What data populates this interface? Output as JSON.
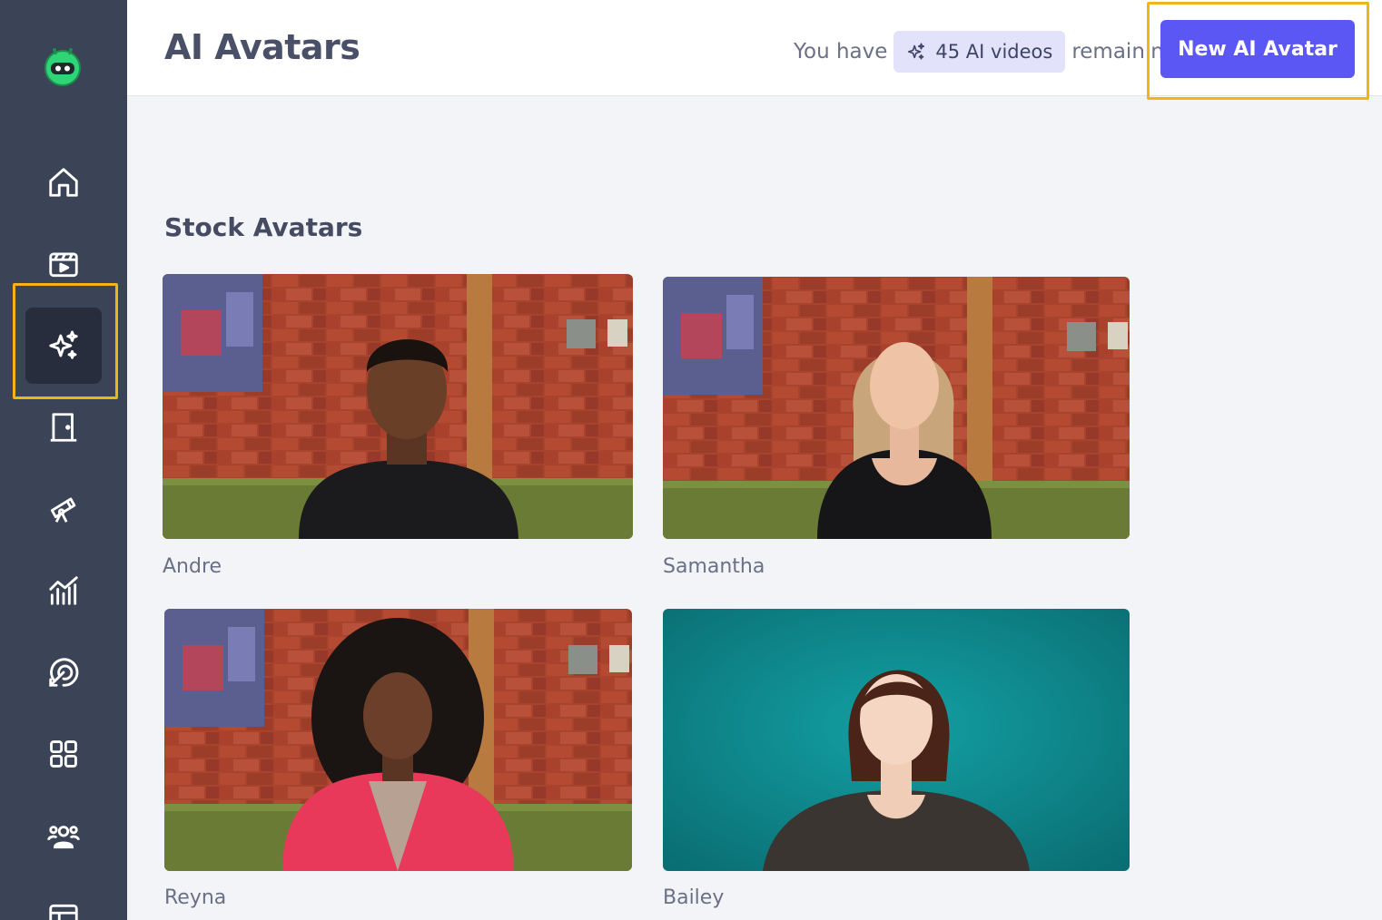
{
  "header": {
    "title": "AI Avatars",
    "remaining_prefix": "You have",
    "remaining_badge": "45 AI videos",
    "remaining_suffix": "remaining",
    "new_button_label": "New AI Avatar"
  },
  "sidebar": {
    "items": [
      {
        "icon": "home-icon"
      },
      {
        "icon": "video-clapper-icon"
      },
      {
        "icon": "sparkles-icon",
        "active": true
      },
      {
        "icon": "door-icon"
      },
      {
        "icon": "telescope-icon"
      },
      {
        "icon": "analytics-icon"
      },
      {
        "icon": "target-icon"
      },
      {
        "icon": "grid-icon"
      },
      {
        "icon": "team-icon"
      },
      {
        "icon": "table-icon"
      }
    ]
  },
  "main": {
    "section_title": "Stock Avatars",
    "avatars": [
      {
        "name": "Andre",
        "background": "brick"
      },
      {
        "name": "Samantha",
        "background": "brick"
      },
      {
        "name": "Reyna",
        "background": "brick"
      },
      {
        "name": "Bailey",
        "background": "teal"
      }
    ]
  },
  "colors": {
    "sidebar": "#3b4357",
    "sidebar_active": "#272d3c",
    "accent": "#5b57f5",
    "highlight": "#f2b416",
    "badge_bg": "#e2e3fb"
  }
}
